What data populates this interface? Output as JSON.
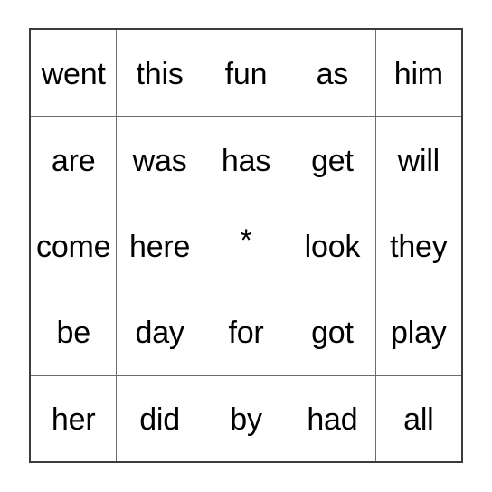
{
  "card": {
    "type": "bingo-card",
    "columns": 5,
    "rows": 5,
    "free_space_marker": "*",
    "free_space_position": {
      "row": 2,
      "col": 2
    },
    "colors": {
      "background": "#ffffff",
      "outer_border": "#3c3c3c",
      "grid_line": "#6b6b6b",
      "text": "#000000"
    },
    "grid": [
      [
        "went",
        "this",
        "fun",
        "as",
        "him"
      ],
      [
        "are",
        "was",
        "has",
        "get",
        "will"
      ],
      [
        "come",
        "here",
        "*",
        "look",
        "they"
      ],
      [
        "be",
        "day",
        "for",
        "got",
        "play"
      ],
      [
        "her",
        "did",
        "by",
        "had",
        "all"
      ]
    ]
  }
}
